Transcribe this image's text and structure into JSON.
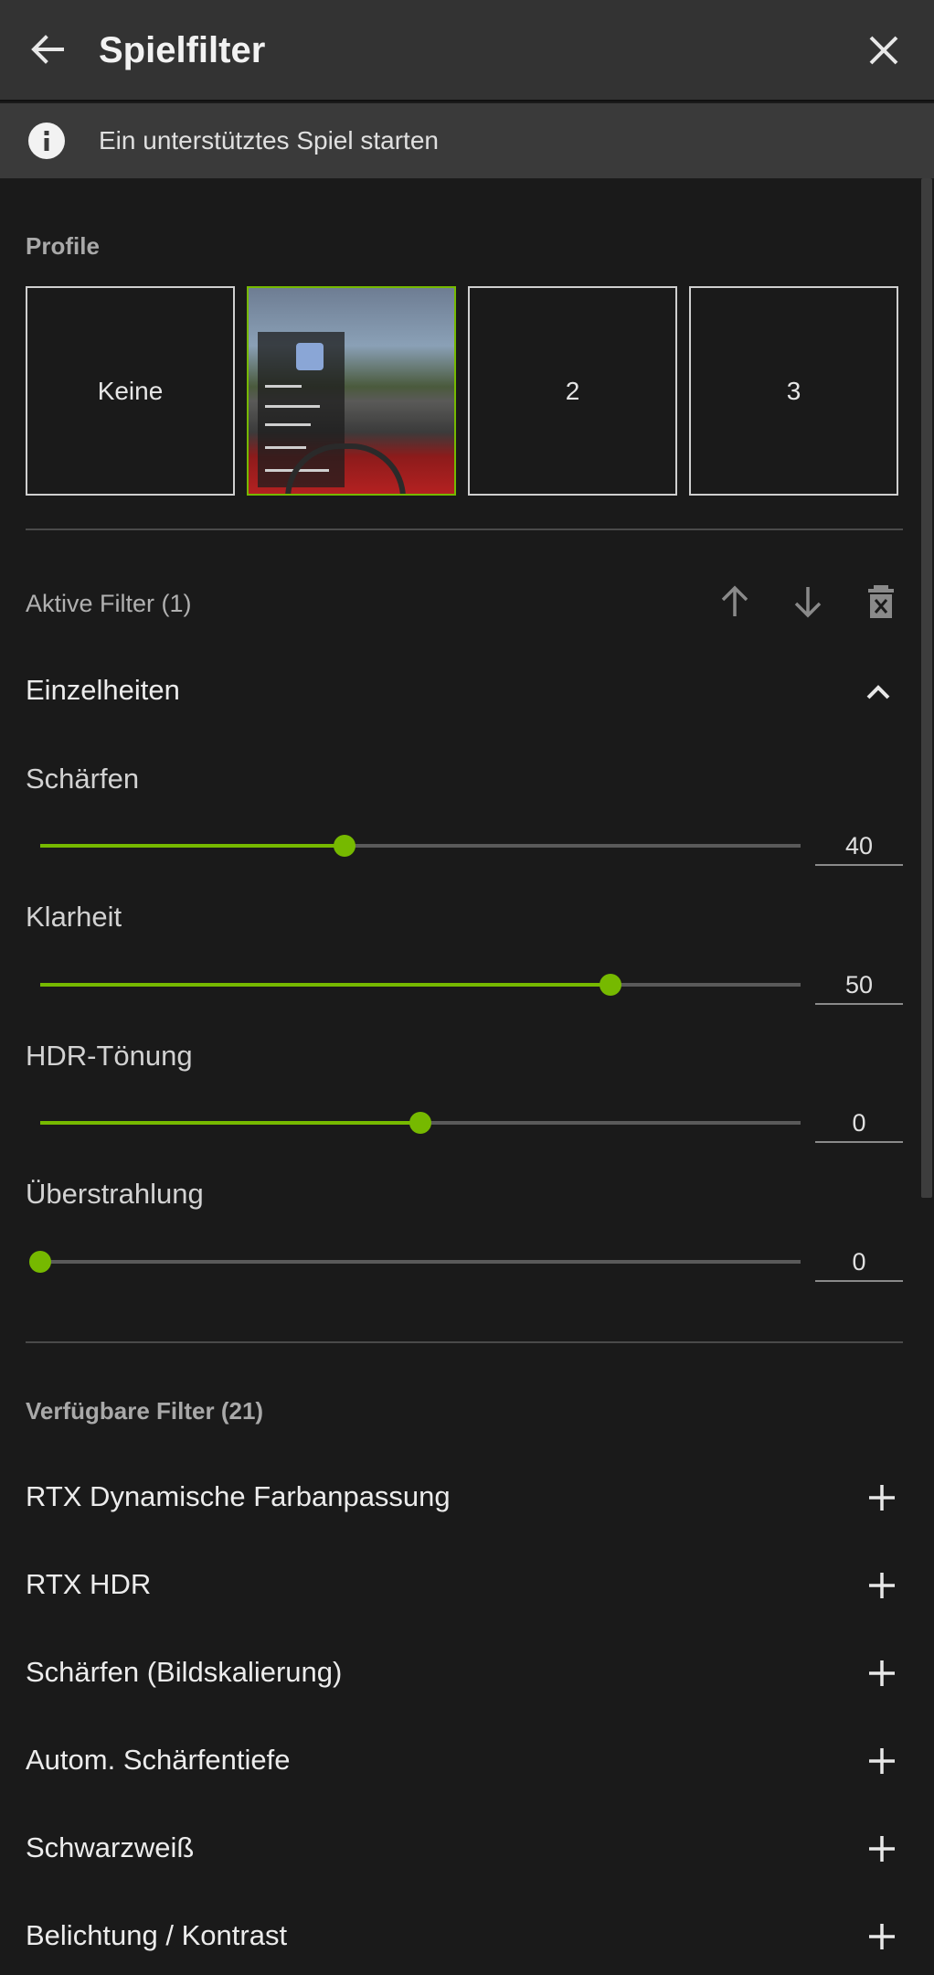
{
  "header": {
    "title": "Spielfilter"
  },
  "info": {
    "text": "Ein unterstütztes Spiel starten"
  },
  "profiles": {
    "label": "Profile",
    "tiles": [
      {
        "label": "Keine",
        "selected": false
      },
      {
        "label": "",
        "selected": true
      },
      {
        "label": "2",
        "selected": false
      },
      {
        "label": "3",
        "selected": false
      }
    ]
  },
  "active_filters": {
    "label": "Aktive Filter (1)",
    "group": {
      "title": "Einzelheiten",
      "sliders": [
        {
          "label": "Schärfen",
          "value": "40",
          "level": 0.4
        },
        {
          "label": "Klarheit",
          "value": "50",
          "level": 0.75
        },
        {
          "label": "HDR-Tönung",
          "value": "0",
          "level": 0.5
        },
        {
          "label": "Überstrahlung",
          "value": "0",
          "level": 0.0
        }
      ]
    }
  },
  "available_filters": {
    "label": "Verfügbare Filter (21)",
    "items": [
      "RTX Dynamische Farbanpassung",
      "RTX HDR",
      "Schärfen (Bildskalierung)",
      "Autom. Schärfentiefe",
      "Schwarzweiß",
      "Belichtung / Kontrast"
    ]
  },
  "colors": {
    "accent": "#76b900",
    "background": "#1a1a1a",
    "header": "#333333"
  },
  "icons": [
    "arrow-left-icon",
    "close-icon",
    "info-icon",
    "arrow-up-icon",
    "arrow-down-icon",
    "delete-icon",
    "chevron-up-icon",
    "plus-icon"
  ]
}
